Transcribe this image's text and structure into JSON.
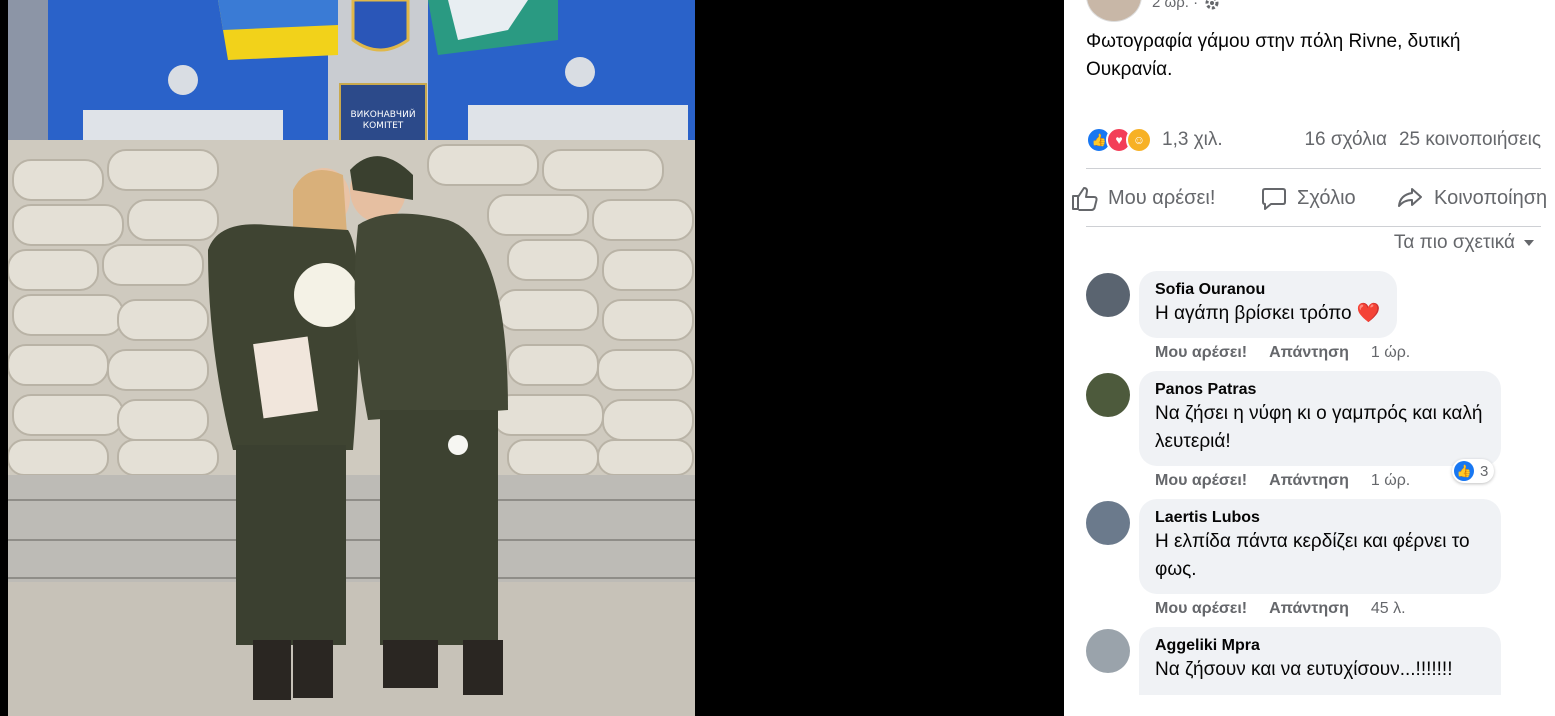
{
  "post": {
    "time": "2 ώρ. ·",
    "text": "Φωτογραφία γάμου στην πόλη Rivne, δυτική Ουκρανία.",
    "reactions_count": "1,3 χιλ.",
    "comments_count": "16 σχόλια",
    "shares_count": "25 κοινοποιήσεις",
    "reaction_icons": [
      "like-icon",
      "love-icon",
      "care-icon"
    ]
  },
  "photo": {
    "sign_line1": "ВИКОНАВЧИЙ",
    "sign_line2": "КОМІТЕТ"
  },
  "actions": {
    "like": "Μου αρέσει!",
    "comment": "Σχόλιο",
    "share": "Κοινοποίηση"
  },
  "sort_label": "Τα πιο σχετικά",
  "comments": [
    {
      "name": "Sofia Ouranou",
      "text": "Η αγάπη βρίσκει τρόπο",
      "emoji": "❤️",
      "like": "Μου αρέσει!",
      "reply": "Απάντηση",
      "time": "1 ώρ."
    },
    {
      "name": "Panos Patras",
      "text": "Να ζήσει η νύφη κι ο γαμπρός και καλή λευτεριά!",
      "like": "Μου αρέσει!",
      "reply": "Απάντηση",
      "time": "1 ώρ.",
      "reactions": "3"
    },
    {
      "name": "Laertis Lubos",
      "text": "Η ελπίδα πάντα κερδίζει και φέρνει το φως.",
      "like": "Μου αρέσει!",
      "reply": "Απάντηση",
      "time": "45 λ."
    },
    {
      "name": "Aggeliki Mpra",
      "text": "Να ζήσουν και να ευτυχίσουν...!!!!!!!"
    }
  ],
  "colors": {
    "accent": "#1877f2",
    "love": "#f33e58",
    "care": "#f7b125",
    "bubble": "#f0f2f5"
  }
}
